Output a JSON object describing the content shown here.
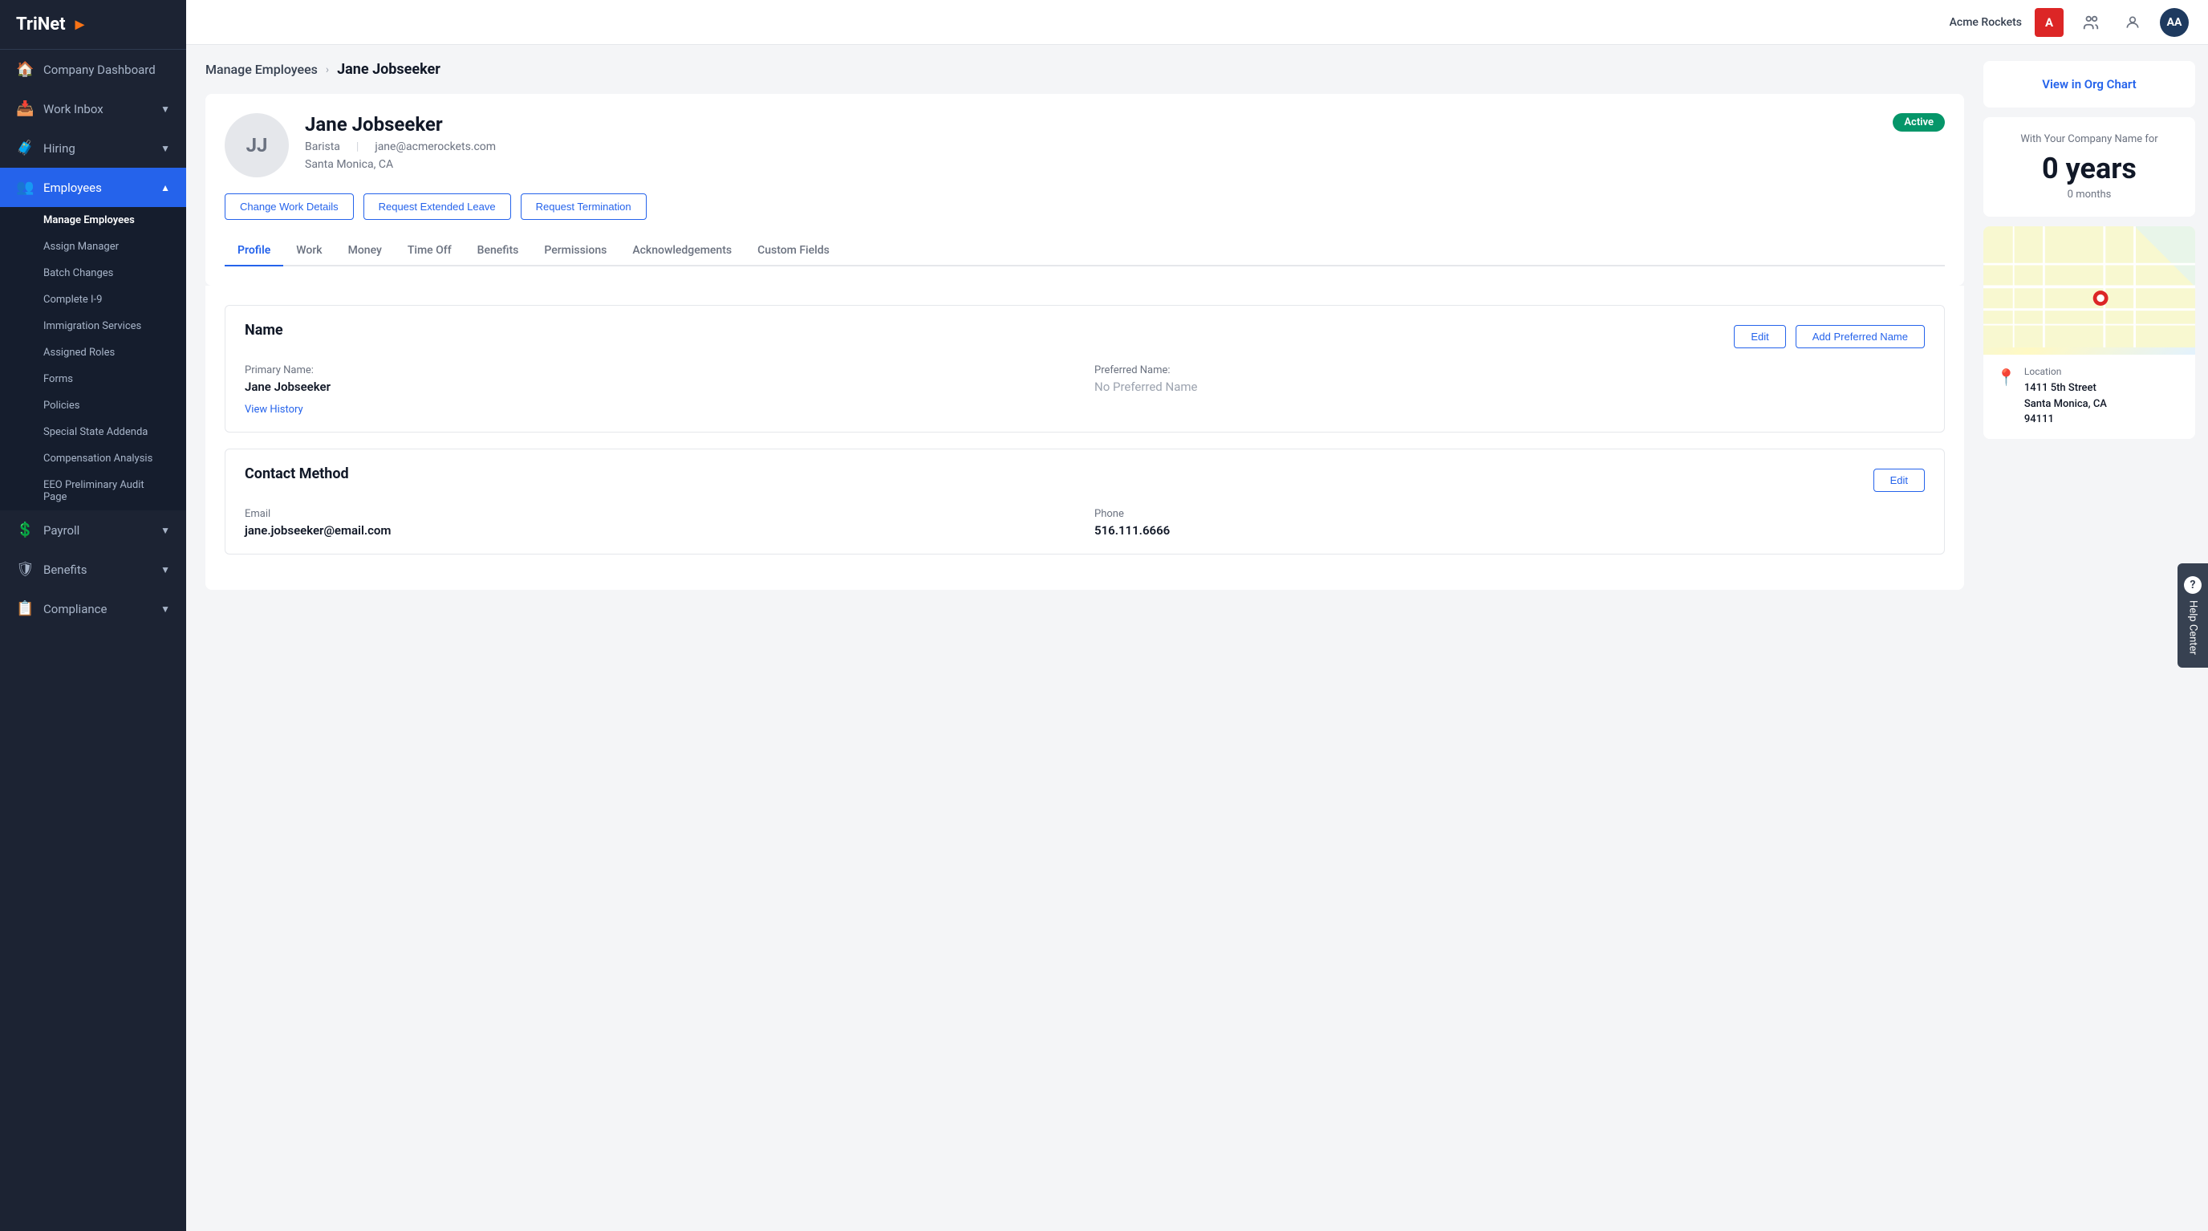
{
  "app": {
    "logo": "TriNet",
    "logo_arrow": "▶"
  },
  "topbar": {
    "company_name": "Acme Rockets",
    "brand_badge": "A",
    "avatar": "AA"
  },
  "sidebar": {
    "items": [
      {
        "id": "company-dashboard",
        "label": "Company Dashboard",
        "icon": "🏠",
        "active": false,
        "expandable": false
      },
      {
        "id": "work-inbox",
        "label": "Work Inbox",
        "icon": "📥",
        "active": false,
        "expandable": true
      },
      {
        "id": "hiring",
        "label": "Hiring",
        "icon": "🧳",
        "active": false,
        "expandable": true
      },
      {
        "id": "employees",
        "label": "Employees",
        "icon": "👥",
        "active": true,
        "expandable": true
      },
      {
        "id": "payroll",
        "label": "Payroll",
        "icon": "💲",
        "active": false,
        "expandable": true
      },
      {
        "id": "benefits",
        "label": "Benefits",
        "icon": "🛡",
        "active": false,
        "expandable": true
      },
      {
        "id": "compliance",
        "label": "Compliance",
        "icon": "📋",
        "active": false,
        "expandable": true
      }
    ],
    "employees_submenu": [
      {
        "id": "manage-employees",
        "label": "Manage Employees",
        "active": true
      },
      {
        "id": "assign-manager",
        "label": "Assign Manager",
        "active": false
      },
      {
        "id": "batch-changes",
        "label": "Batch Changes",
        "active": false
      },
      {
        "id": "complete-i9",
        "label": "Complete I-9",
        "active": false
      },
      {
        "id": "immigration-services",
        "label": "Immigration Services",
        "active": false
      },
      {
        "id": "assigned-roles",
        "label": "Assigned Roles",
        "active": false
      },
      {
        "id": "forms",
        "label": "Forms",
        "active": false
      },
      {
        "id": "policies",
        "label": "Policies",
        "active": false
      },
      {
        "id": "special-state-addenda",
        "label": "Special State Addenda",
        "active": false
      },
      {
        "id": "compensation-analysis",
        "label": "Compensation Analysis",
        "active": false
      },
      {
        "id": "eeo-preliminary-audit",
        "label": "EEO Preliminary Audit Page",
        "active": false
      }
    ]
  },
  "breadcrumb": {
    "parent": "Manage Employees",
    "current": "Jane Jobseeker"
  },
  "employee": {
    "initials": "JJ",
    "name": "Jane Jobseeker",
    "title": "Barista",
    "email": "jane@acmerockets.com",
    "location": "Santa Monica, CA",
    "status": "Active"
  },
  "actions": {
    "change_work_details": "Change Work Details",
    "request_extended_leave": "Request Extended Leave",
    "request_termination": "Request Termination"
  },
  "tabs": [
    {
      "id": "profile",
      "label": "Profile",
      "active": true
    },
    {
      "id": "work",
      "label": "Work",
      "active": false
    },
    {
      "id": "money",
      "label": "Money",
      "active": false
    },
    {
      "id": "time-off",
      "label": "Time Off",
      "active": false
    },
    {
      "id": "benefits",
      "label": "Benefits",
      "active": false
    },
    {
      "id": "permissions",
      "label": "Permissions",
      "active": false
    },
    {
      "id": "acknowledgements",
      "label": "Acknowledgements",
      "active": false
    },
    {
      "id": "custom-fields",
      "label": "Custom Fields",
      "active": false
    }
  ],
  "profile": {
    "name_section": {
      "title": "Name",
      "edit_label": "Edit",
      "add_preferred_label": "Add Preferred Name",
      "primary_name_label": "Primary Name:",
      "primary_name_value": "Jane Jobseeker",
      "preferred_name_label": "Preferred Name:",
      "preferred_name_placeholder": "No Preferred Name",
      "view_history_label": "View History"
    },
    "contact_section": {
      "title": "Contact Method",
      "edit_label": "Edit",
      "email_label": "Email",
      "email_value": "jane.jobseeker@email.com",
      "phone_label": "Phone",
      "phone_value": "516.111.6666"
    }
  },
  "right_panel": {
    "view_org_chart": "View in Org Chart",
    "tenure_subtitle": "With Your Company Name for",
    "tenure_years": "0 years",
    "tenure_months": "0 months",
    "location_label": "Location",
    "location_address_line1": "1411 5th Street",
    "location_address_line2": "Santa Monica, CA",
    "location_address_line3": "94111"
  },
  "help_center": {
    "icon": "?",
    "label": "Help Center"
  }
}
